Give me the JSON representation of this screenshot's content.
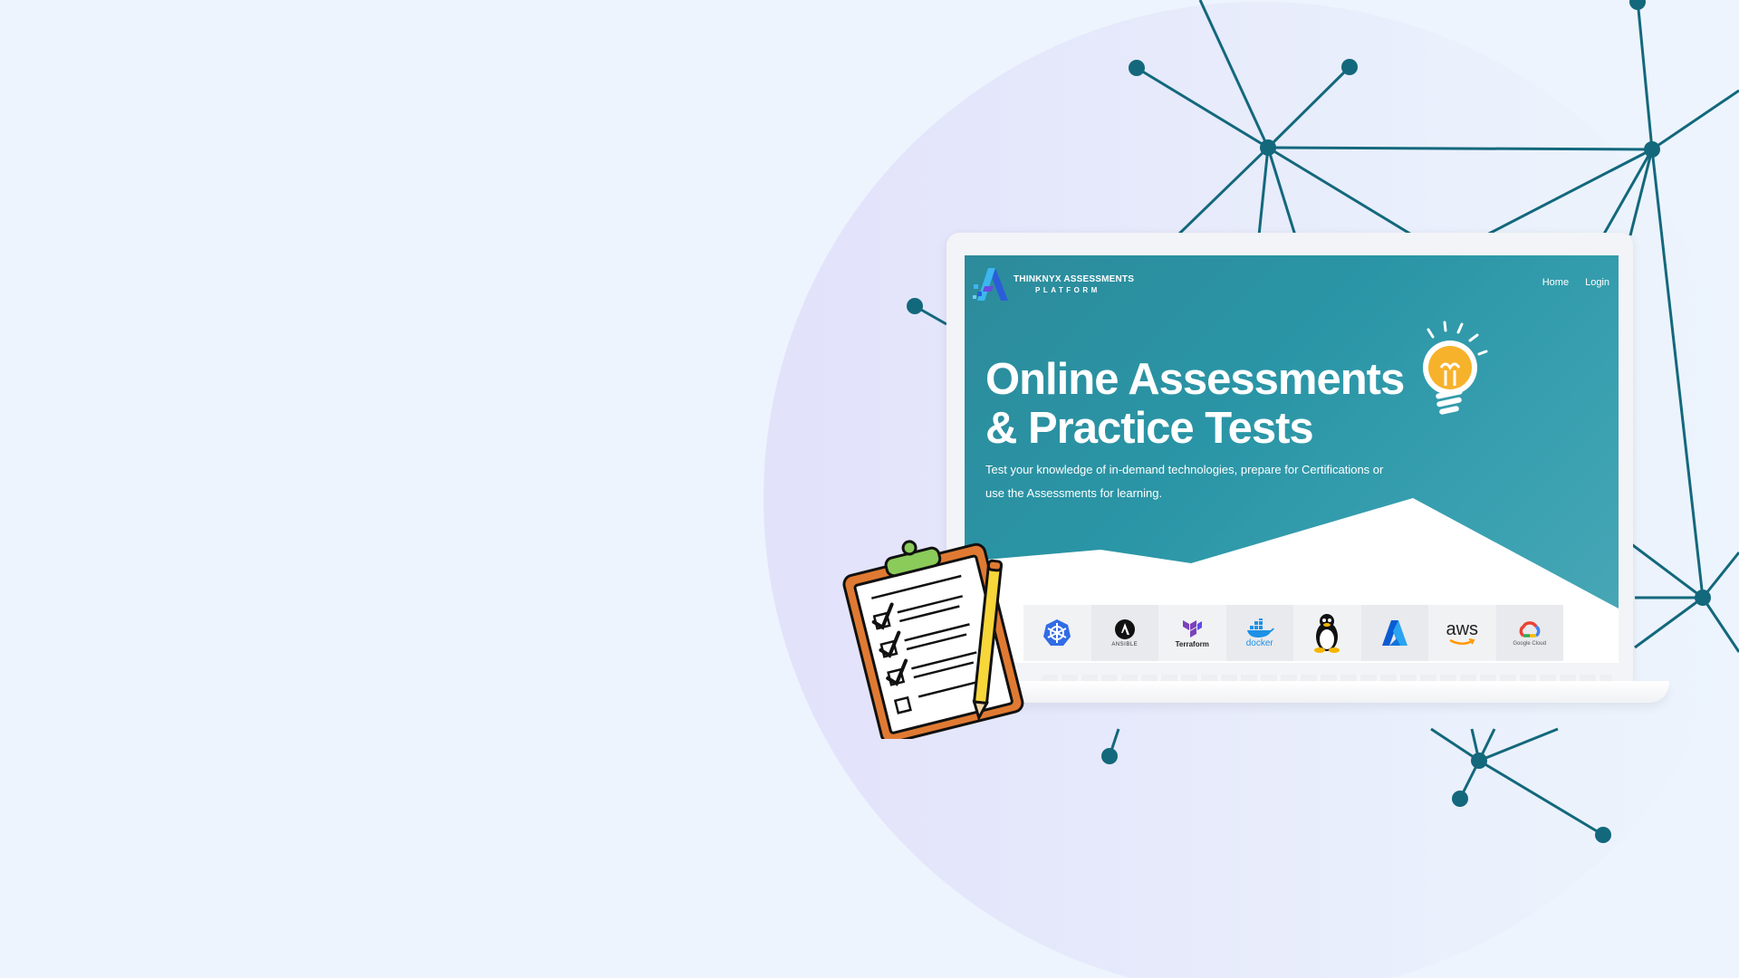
{
  "site": {
    "brand_line1": "THINKNYX ASSESSMENTS",
    "brand_line2": "PLATFORM",
    "nav": [
      "Home",
      "Login"
    ]
  },
  "hero": {
    "headline_line1": "Online Assessments",
    "headline_line2": "& Practice Tests",
    "subtext": "Test your knowledge of in-demand technologies, prepare for Certifications or use the Assessments for learning."
  },
  "technologies": [
    {
      "name": "kubernetes-icon",
      "label": ""
    },
    {
      "name": "ansible-icon",
      "label": "ANSIBLE"
    },
    {
      "name": "terraform-icon",
      "label": "Terraform"
    },
    {
      "name": "docker-icon",
      "label": "docker"
    },
    {
      "name": "linux-icon",
      "label": ""
    },
    {
      "name": "azure-icon",
      "label": ""
    },
    {
      "name": "aws-icon",
      "label": "aws"
    },
    {
      "name": "google-cloud-icon",
      "label": "Google Cloud"
    }
  ],
  "colors": {
    "background": "#edf4fd",
    "hero_teal": "#2c8b9b",
    "network_nodes": "#13687c",
    "clipboard_orange": "#e07a32",
    "clip_green": "#8acb5a",
    "bulb_yellow": "#f7b22c"
  }
}
